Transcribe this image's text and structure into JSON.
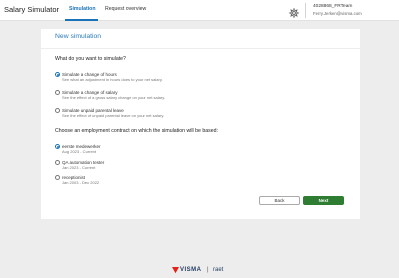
{
  "header": {
    "app_title": "Salary Simulator",
    "tabs": [
      {
        "label": "Simulation",
        "active": true
      },
      {
        "label": "Request overview",
        "active": false
      }
    ],
    "user": {
      "id": "4028868_FRTeam",
      "email": "Ferry.Jerken@visma.com"
    },
    "settings_icon": "gear-icon"
  },
  "page": {
    "title": "New simulation",
    "question1": "What do you want to simulate?",
    "options": [
      {
        "label": "Simulate a change of hours",
        "sub": "See what an adjustment in hours does to your net salary.",
        "checked": true
      },
      {
        "label": "Simulate a change of salary",
        "sub": "See the effect of a gross salary change on your net salary.",
        "checked": false
      },
      {
        "label": "Simulate unpaid parental leave",
        "sub": "See the effect of unpaid parental leave on your net salary.",
        "checked": false
      }
    ],
    "question2": "Choose an employment contract on which the simulation will be based:",
    "contracts": [
      {
        "label": "eerste medewerker",
        "period": "Aug 2023 - Current",
        "checked": true
      },
      {
        "label": "QA automation tester",
        "period": "Jan 2023 - Current",
        "checked": false
      },
      {
        "label": "receptionist",
        "period": "Jan 2003 - Dec 2022",
        "checked": false
      }
    ],
    "back_label": "Back",
    "next_label": "Next"
  },
  "footer": {
    "brand": "VISMA",
    "separator": "|",
    "product": "raet"
  },
  "colors": {
    "accent": "#1a73b8",
    "primary_button": "#2e7d32",
    "background": "#ededed"
  }
}
